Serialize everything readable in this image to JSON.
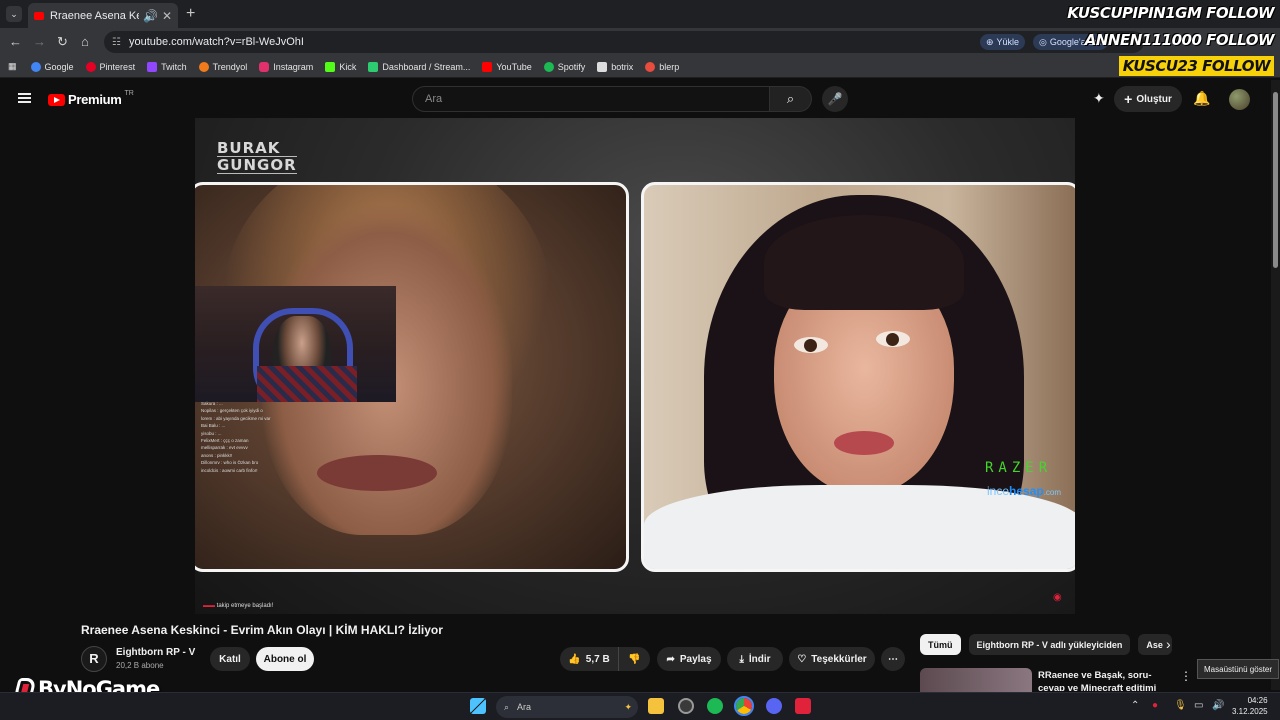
{
  "browser": {
    "tab_title": "Rraenee Asena Keskinci - E",
    "url": "youtube.com/watch?v=rBl-WeJvOhI",
    "upload_label": "Yükle",
    "google_ask_label": "Google'a Sor"
  },
  "bookmarks": [
    {
      "label": "Google",
      "color": "#4285f4"
    },
    {
      "label": "Pinterest",
      "color": "#e60023"
    },
    {
      "label": "Twitch",
      "color": "#9146ff"
    },
    {
      "label": "Trendyol",
      "color": "#f27a1a"
    },
    {
      "label": "Instagram",
      "color": "#e1306c"
    },
    {
      "label": "Kick",
      "color": "#53fc18"
    },
    {
      "label": "Dashboard / Stream...",
      "color": "#2ecc71"
    },
    {
      "label": "YouTube",
      "color": "#ff0000"
    },
    {
      "label": "Spotify",
      "color": "#1db954"
    },
    {
      "label": "botrix",
      "color": "#dddddd"
    },
    {
      "label": "blerp",
      "color": "#e74c3c"
    }
  ],
  "overlay": {
    "follow1": "KUSCUPIPIN1GM  FOLLOW",
    "follow2": "ANNEN111000  FOLLOW",
    "follow3": "KUSCU23  FOLLOW",
    "brand": "ByNoGame"
  },
  "youtube": {
    "logo_text": "Premium",
    "logo_sup": "TR",
    "search_placeholder": "Ara",
    "create_label": "Oluştur"
  },
  "video": {
    "watermark_line1": "BURAK",
    "watermark_line2": "GUNGOR",
    "sponsor1": "RAZER",
    "sponsor2_a": "ince",
    "sponsor2_b": "hesap",
    "sponsor2_c": ".com",
    "follow_note": "takip etmeye başladı!",
    "chat": [
      "Sakura : ...",
      "Nopilas : gerçekten çok iyiydi o",
      "lorem : abi yayında gecikme mi var",
      "Bai Balu : ...",
      "yisobu : ...",
      "FelixMert : ççç o zaman",
      "mellisparrak : evt evvvv",
      "anons : pinkkk!!",
      "Dillonmrv : who is Özkan bro",
      "incoldcis : aowmi carb finfor!"
    ]
  },
  "video_info": {
    "title": "Rraenee Asena Keskinci - Evrim Akın Olayı | KİM HAKLI? İzliyor",
    "channel_name": "Eightborn RP - V",
    "channel_logo": "R",
    "subscribers": "20,2 B abone",
    "join_label": "Katıl",
    "subscribe_label": "Abone ol",
    "like_count": "5,7 B",
    "share_label": "Paylaş",
    "download_label": "İndir",
    "thanks_label": "Teşekkürler"
  },
  "sidebar": {
    "chips": [
      "Tümü",
      "Eightborn RP - V adlı yükleyiciden",
      "Ase"
    ],
    "rec_title": "RRaenee ve Başak, soru-cevap ve Minecraft editimi izliyor"
  },
  "taskbar": {
    "search_placeholder": "Ara",
    "tooltip": "Masaüstünü göster",
    "time": "04:26",
    "date": "3.12.2025"
  },
  "colors": {
    "yt_red": "#ff0000",
    "razer_green": "#44d62c",
    "follow_yellow": "#f7d20a"
  }
}
